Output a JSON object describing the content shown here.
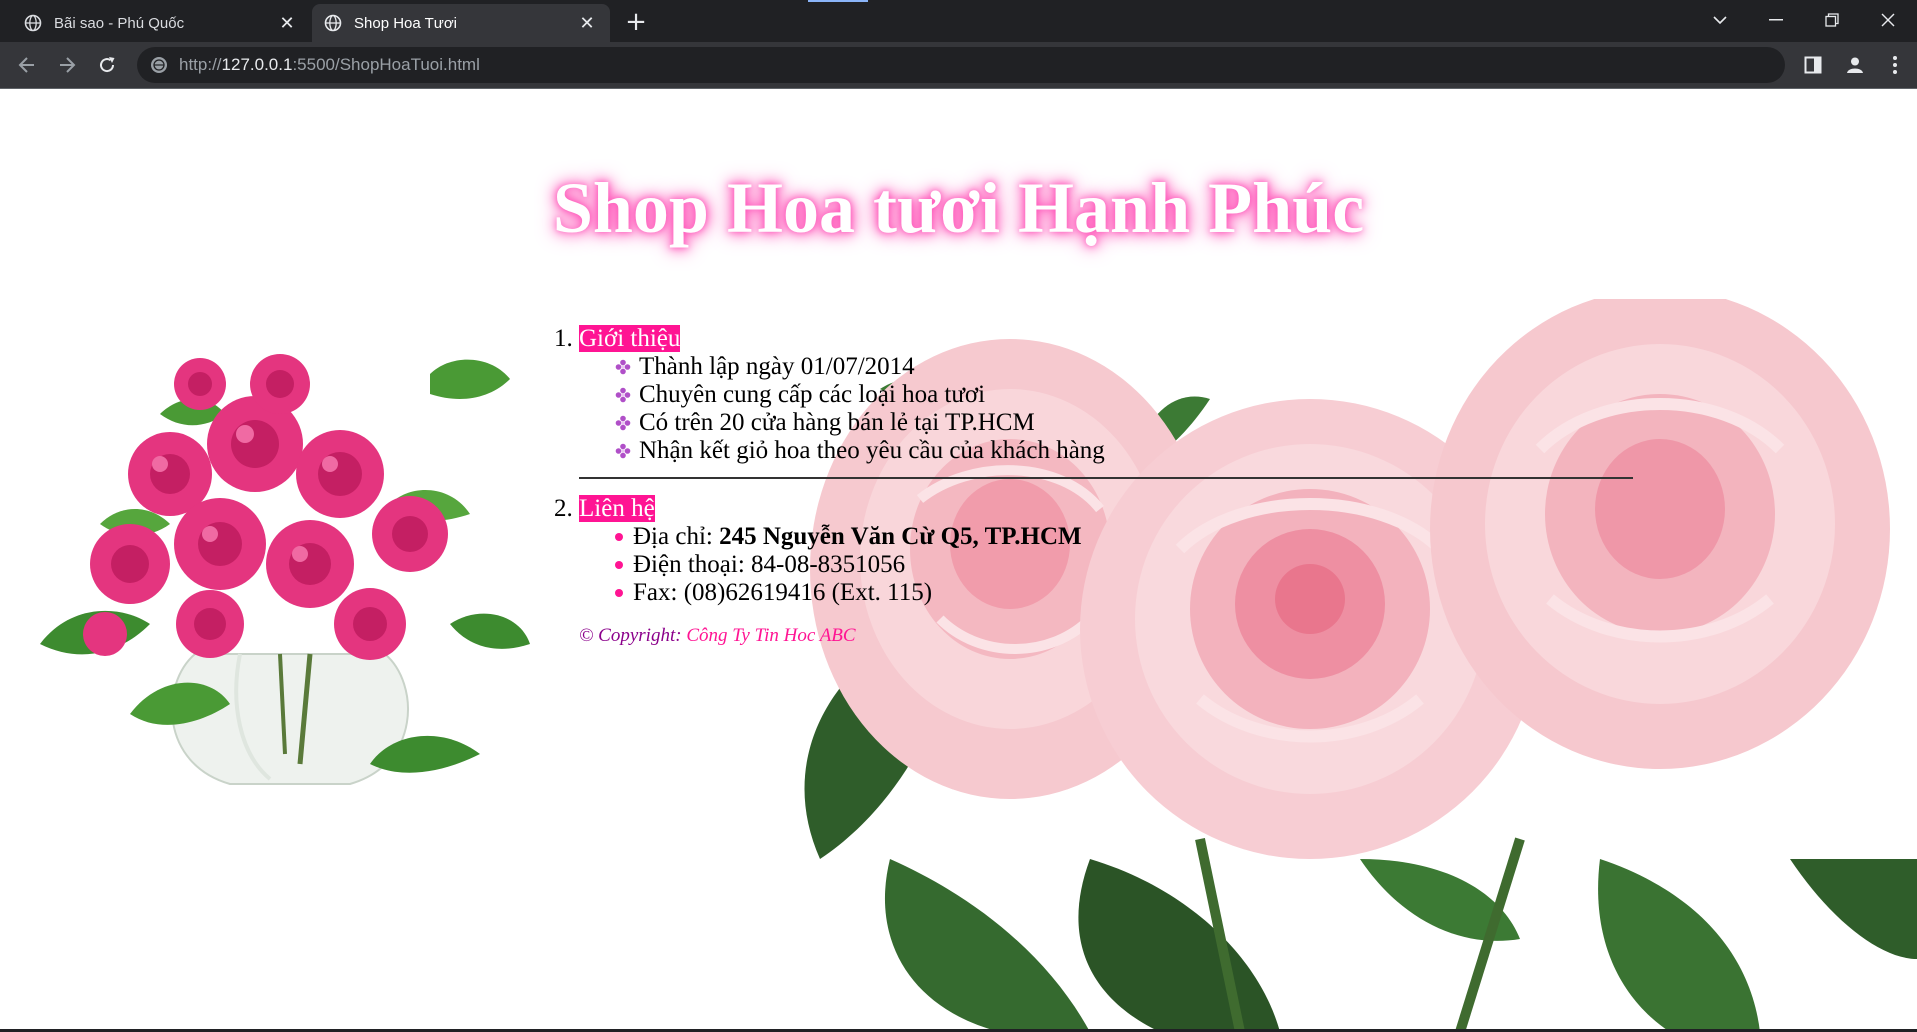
{
  "browser": {
    "tabs": [
      {
        "title": "Bãi sao - Phú Quốc",
        "active": false
      },
      {
        "title": "Shop Hoa Tươi",
        "active": true
      }
    ],
    "url": {
      "scheme": "http://",
      "host": "127.0.0.1",
      "rest": ":5500/ShopHoaTuoi.html"
    },
    "accent_color": "#8ab4f8"
  },
  "page": {
    "title": "Shop Hoa tươi Hạnh Phúc",
    "title_glow_color": "#ff4fb6",
    "label_bg_color": "#ff1493",
    "sections": [
      {
        "label": "Giới thiệu",
        "items": [
          "Thành lập ngày 01/07/2014",
          "Chuyên cung cấp các loại hoa tươi",
          "Có trên 20 cửa hàng bán lẻ tại TP.HCM",
          "Nhận kết giỏ hoa theo yêu cầu của khách hàng"
        ]
      },
      {
        "label": "Liên hệ",
        "address_label": "Địa chỉ: ",
        "address_value": "245 Nguyễn Văn Cừ Q5, TP.HCM",
        "phone": "Điện thoại: 84-08-8351056",
        "fax": "Fax: (08)62619416 (Ext. 115)"
      }
    ],
    "copyright_prefix": "© Copyright: ",
    "copyright_company": "Công Ty Tin Hoc ABC"
  }
}
